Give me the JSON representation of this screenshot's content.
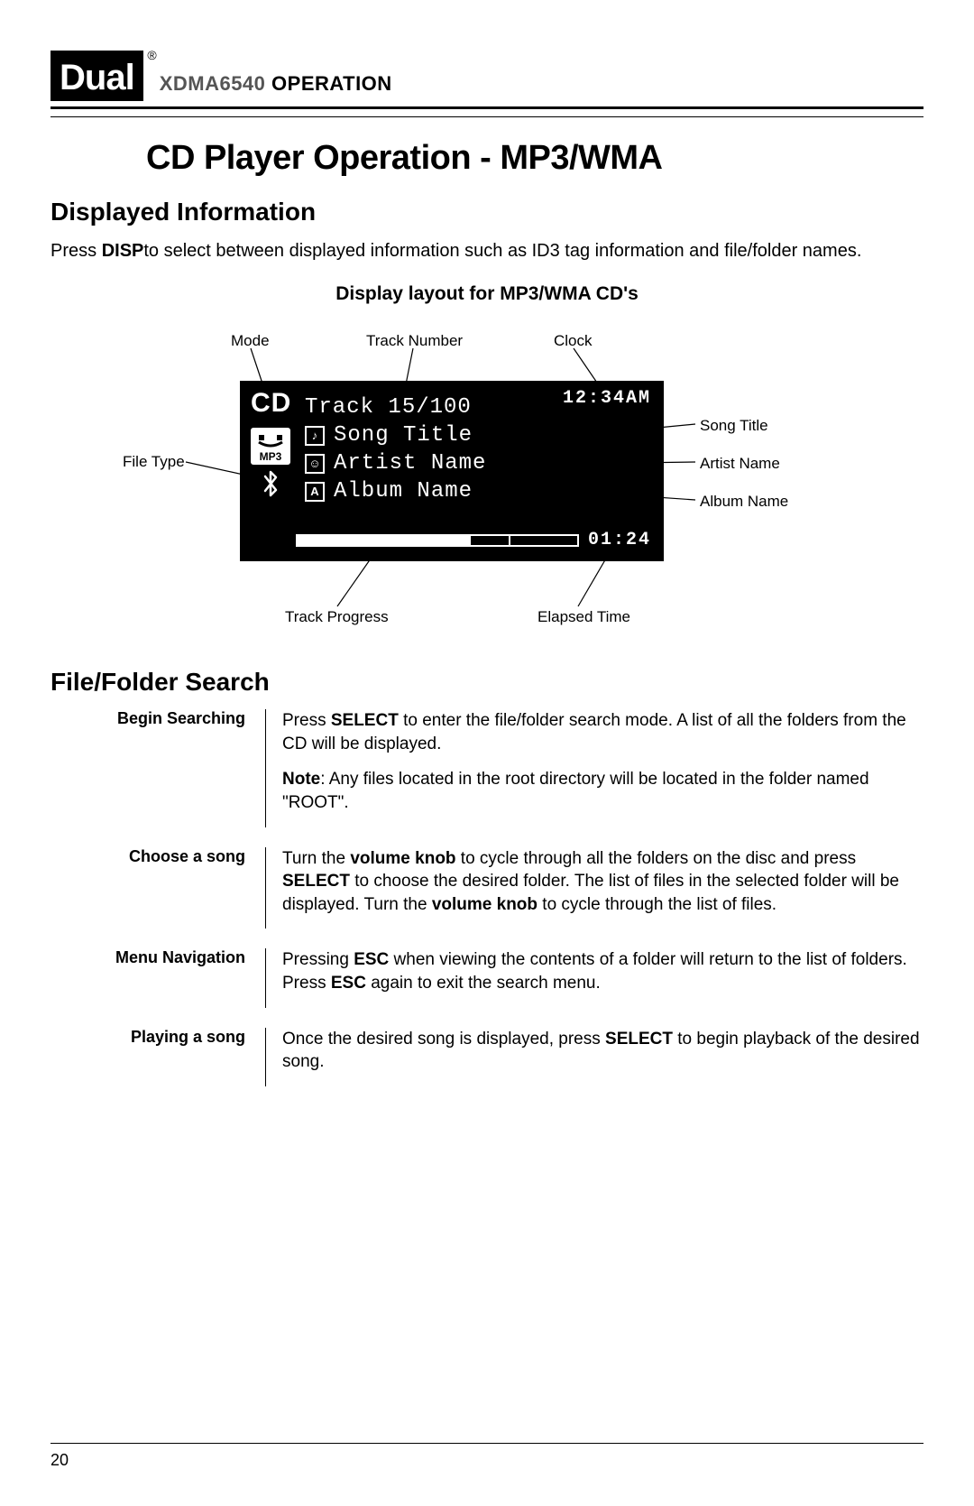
{
  "header": {
    "logo_text": "Dual",
    "registered": "®",
    "model": "XDMA6540",
    "operation_word": "OPERATION"
  },
  "page_title": "CD Player Operation - MP3/WMA",
  "section1": {
    "heading": "Displayed Information",
    "body_pre": "Press ",
    "body_bold": "DISP",
    "body_post": "to select between displayed information such as ID3 tag information and file/folder names.",
    "sub_heading": "Display layout for MP3/WMA CD's"
  },
  "callouts": {
    "mode": "Mode",
    "track_number": "Track Number",
    "clock": "Clock",
    "file_type": "File Type",
    "song_title": "Song Title",
    "artist_name": "Artist Name",
    "album_name": "Album Name",
    "track_progress": "Track Progress",
    "elapsed_time": "Elapsed Time"
  },
  "lcd": {
    "cd": "CD",
    "clock": "12:34AM",
    "track": "Track 15/100",
    "song_title_label": "Song Title",
    "artist_name_label": "Artist Name",
    "album_name_label": "Album Name",
    "mp3_label": "MP3",
    "elapsed": "01:24",
    "note_icon": "♪",
    "artist_icon": "☺",
    "album_icon": "A",
    "bt_glyph": "ᚼ"
  },
  "section2": {
    "heading": "File/Folder Search",
    "rows": [
      {
        "label": "Begin Searching",
        "paras": [
          {
            "segments": [
              {
                "t": "Press "
              },
              {
                "b": "SELECT"
              },
              {
                "t": " to enter the file/folder search mode. A list of all the folders from the CD will be displayed."
              }
            ]
          },
          {
            "segments": [
              {
                "b": "Note"
              },
              {
                "t": ": Any files located in the root directory will be located in the folder named \"ROOT\"."
              }
            ]
          }
        ]
      },
      {
        "label": "Choose a song",
        "paras": [
          {
            "segments": [
              {
                "t": "Turn the "
              },
              {
                "b": "volume knob"
              },
              {
                "t": " to cycle through all the folders on the disc and press "
              },
              {
                "b": "SELECT"
              },
              {
                "t": " to choose the desired folder. The list of files in the selected folder will be displayed. Turn the "
              },
              {
                "b": "volume knob"
              },
              {
                "t": " to cycle through the list of files."
              }
            ]
          }
        ]
      },
      {
        "label": "Menu Navigation",
        "paras": [
          {
            "segments": [
              {
                "t": "Pressing "
              },
              {
                "b": "ESC"
              },
              {
                "t": " when viewing the contents of a folder will return to the list of folders. Press "
              },
              {
                "b": "ESC"
              },
              {
                "t": " again to exit the search menu."
              }
            ]
          }
        ]
      },
      {
        "label": "Playing a song",
        "paras": [
          {
            "segments": [
              {
                "t": "Once the desired song is displayed, press "
              },
              {
                "b": "SELECT"
              },
              {
                "t": " to begin playback of the desired song."
              }
            ]
          }
        ]
      }
    ]
  },
  "page_number": "20"
}
